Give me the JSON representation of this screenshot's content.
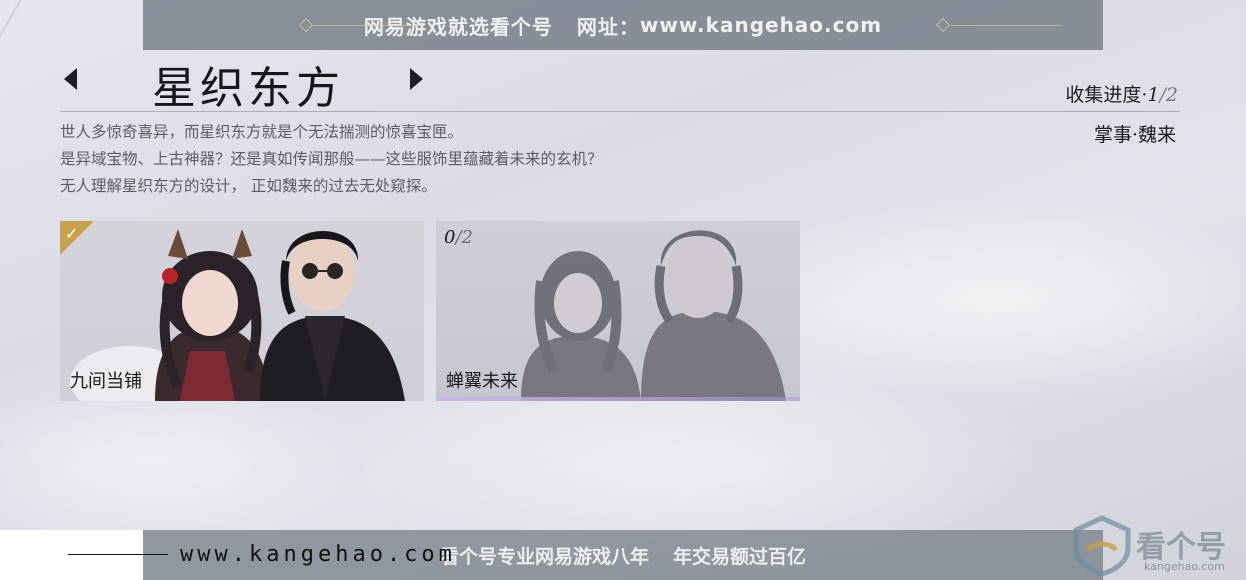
{
  "watermark": {
    "top_text": "网易游戏就选看个号",
    "top_url_label": "网址：",
    "top_url": "www.kangehao.com",
    "bottom_text": "看个号专业网易游戏八年",
    "bottom_text2": "年交易额过百亿",
    "bottom_url": "www.kangehao.com",
    "logo_text": "看个号",
    "logo_sub": "kangehao.com"
  },
  "header": {
    "title": "星织东方",
    "progress_label": "收集进度·",
    "progress_current": "1",
    "progress_sep": "/",
    "progress_total": "2",
    "author": "掌事·魏来"
  },
  "description": {
    "line1": "世人多惊奇喜异，而星织东方就是个无法揣测的惊喜宝匣。",
    "line2": "是异域宝物、上古神器？还是真如传闻那般——这些服饰里蕴藏着未来的玄机？",
    "line3": "无人理解星织东方的设计， 正如魏来的过去无处窥探。"
  },
  "cards": [
    {
      "label": "九间当铺",
      "collected": true
    },
    {
      "label": "蝉翼未来",
      "count_current": "0",
      "count_sep": "/",
      "count_total": "2"
    }
  ],
  "colors": {
    "accent_gold": "#c9a24d",
    "glow_purple": "#b8a0e0"
  }
}
